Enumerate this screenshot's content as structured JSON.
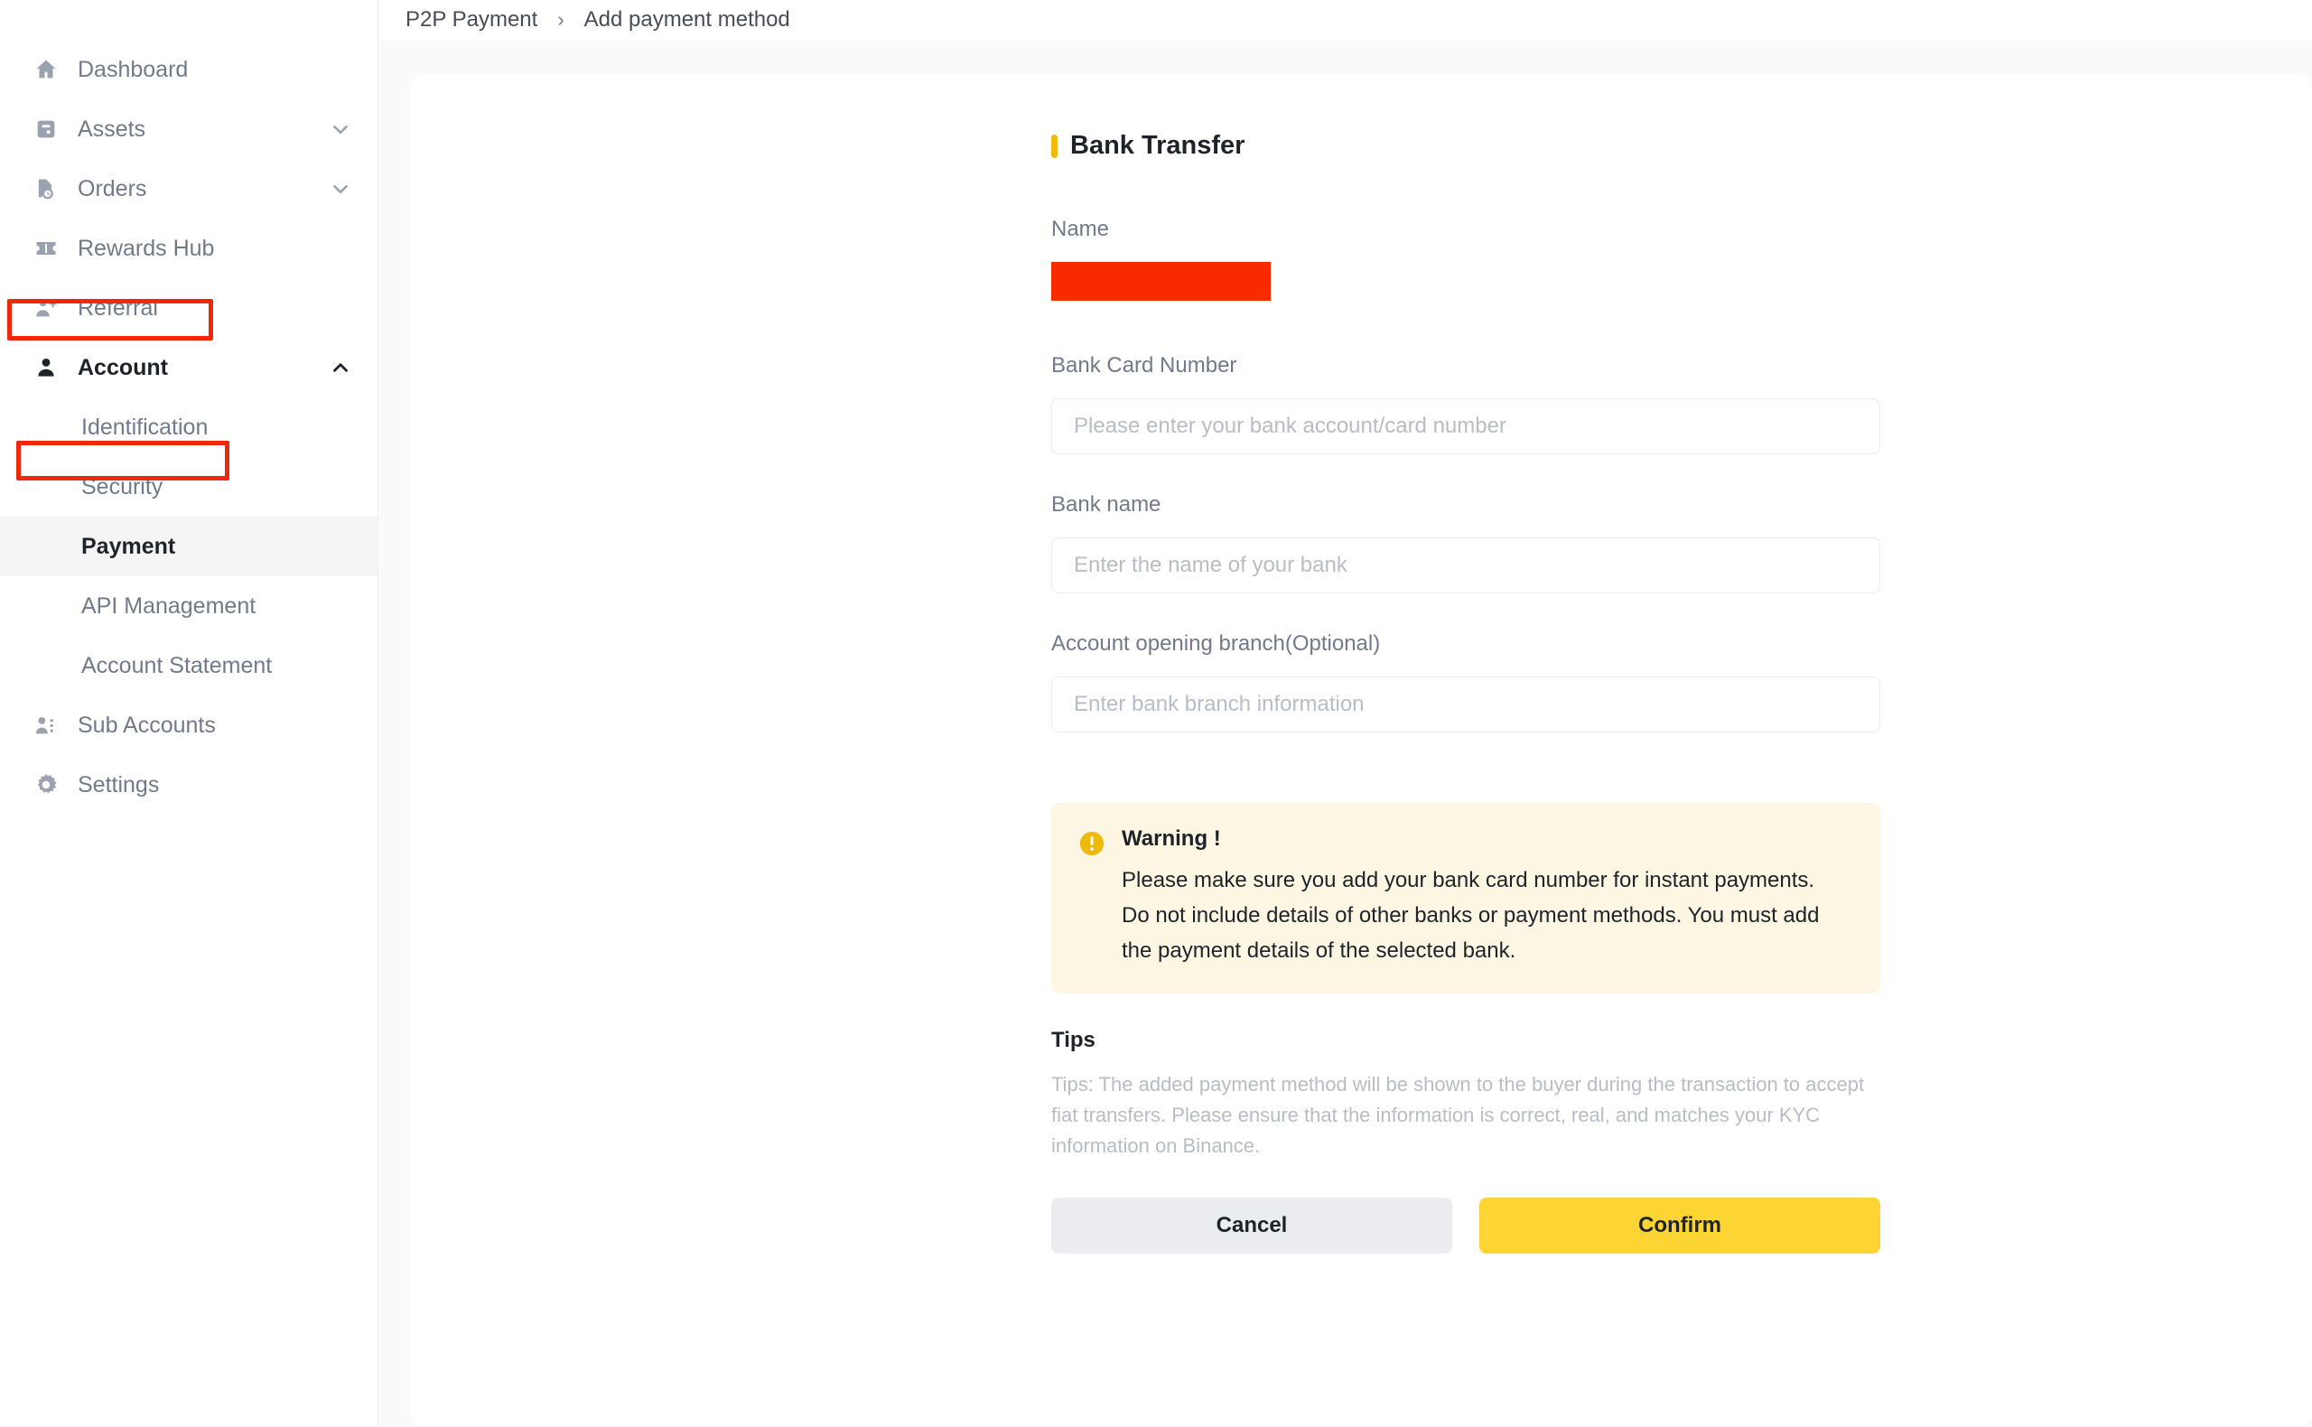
{
  "breadcrumb": {
    "root": "P2P Payment",
    "separator": "›",
    "current": "Add payment method"
  },
  "sidebar": {
    "items": [
      {
        "label": "Dashboard",
        "icon": "home-icon",
        "expandable": false,
        "state": "default"
      },
      {
        "label": "Assets",
        "icon": "wallet-icon",
        "expandable": true,
        "chevron": "chevron-down-icon",
        "state": "default"
      },
      {
        "label": "Orders",
        "icon": "order-clock-icon",
        "expandable": true,
        "chevron": "chevron-down-icon",
        "state": "default"
      },
      {
        "label": "Rewards Hub",
        "icon": "ticket-icon",
        "expandable": false,
        "state": "default"
      },
      {
        "label": "Referral",
        "icon": "person-plus-icon",
        "expandable": false,
        "state": "default"
      },
      {
        "label": "Account",
        "icon": "person-icon",
        "expandable": true,
        "chevron": "chevron-up-icon",
        "state": "active"
      }
    ],
    "account_children": [
      {
        "label": "Identification",
        "state": "default"
      },
      {
        "label": "Security",
        "state": "default"
      },
      {
        "label": "Payment",
        "state": "selected"
      },
      {
        "label": "API Management",
        "state": "default"
      },
      {
        "label": "Account Statement",
        "state": "default"
      }
    ],
    "items_after": [
      {
        "label": "Sub Accounts",
        "icon": "people-list-icon",
        "expandable": false,
        "state": "default"
      },
      {
        "label": "Settings",
        "icon": "gear-icon",
        "expandable": false,
        "state": "default"
      }
    ]
  },
  "annotations": {
    "color": "#f0280a",
    "boxes": [
      "account-nav-item",
      "payment-sub-item"
    ]
  },
  "form": {
    "title": "Bank Transfer",
    "accent_color": "#f0b90b",
    "fields": [
      {
        "label": "Name",
        "type": "redacted",
        "redaction_color": "#fa2a00",
        "value": ""
      },
      {
        "label": "Bank Card Number",
        "type": "text",
        "value": "",
        "placeholder": "Please enter your bank account/card number"
      },
      {
        "label": "Bank name",
        "type": "text",
        "value": "",
        "placeholder": "Enter the name of your bank"
      },
      {
        "label": "Account opening branch(Optional)",
        "type": "text",
        "value": "",
        "placeholder": "Enter bank branch information"
      }
    ]
  },
  "warning": {
    "icon": "exclamation-circle-icon",
    "icon_color": "#f0b90b",
    "background": "#fdf6e3",
    "title": "Warning !",
    "lines": [
      "Please make sure you add your bank card number for instant payments.",
      "Do not include details of other banks or payment methods. You must add",
      "the payment details of the selected bank."
    ]
  },
  "tips": {
    "title": "Tips",
    "text": "Tips: The added payment method will be shown to the buyer during the transaction to accept fiat transfers. Please ensure that the information is correct, real, and matches your KYC information on Binance."
  },
  "actions": {
    "cancel_label": "Cancel",
    "confirm_label": "Confirm",
    "confirm_color": "#fcd535",
    "cancel_color": "#eaecef"
  }
}
